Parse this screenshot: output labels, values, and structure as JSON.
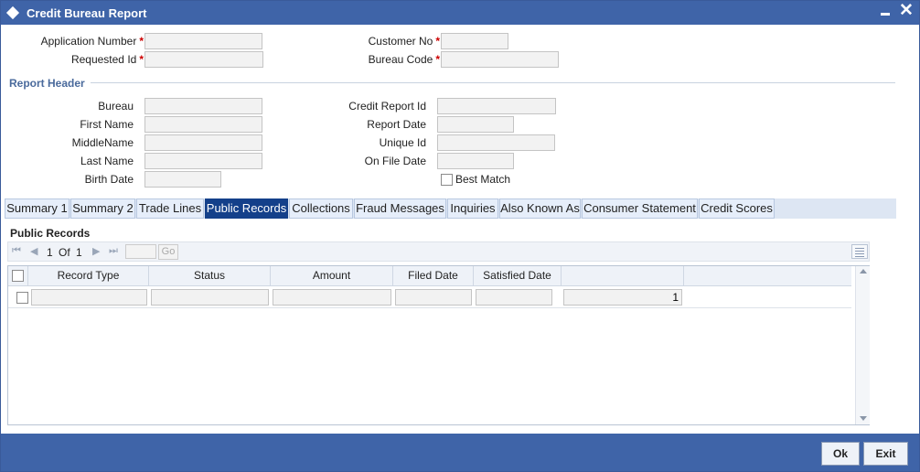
{
  "window": {
    "title": "Credit Bureau Report"
  },
  "form": {
    "application_number": {
      "label": "Application Number",
      "value": ""
    },
    "requested_id": {
      "label": "Requested Id",
      "value": ""
    },
    "customer_no": {
      "label": "Customer No",
      "value": ""
    },
    "bureau_code": {
      "label": "Bureau Code",
      "value": ""
    },
    "required_marker": "*"
  },
  "report_header": {
    "title": "Report Header",
    "bureau": {
      "label": "Bureau",
      "value": ""
    },
    "first_name": {
      "label": "First Name",
      "value": ""
    },
    "middle_name": {
      "label": "MiddleName",
      "value": ""
    },
    "last_name": {
      "label": "Last Name",
      "value": ""
    },
    "birth_date": {
      "label": "Birth Date",
      "value": ""
    },
    "credit_report_id": {
      "label": "Credit Report Id",
      "value": ""
    },
    "report_date": {
      "label": "Report Date",
      "value": ""
    },
    "unique_id": {
      "label": "Unique Id",
      "value": ""
    },
    "on_file_date": {
      "label": "On File Date",
      "value": ""
    },
    "best_match": {
      "label": "Best Match",
      "checked": false
    }
  },
  "tabs": [
    {
      "label": "Summary 1",
      "active": false
    },
    {
      "label": "Summary 2",
      "active": false
    },
    {
      "label": "Trade Lines",
      "active": false
    },
    {
      "label": "Public Records",
      "active": true
    },
    {
      "label": "Collections",
      "active": false
    },
    {
      "label": "Fraud Messages",
      "active": false
    },
    {
      "label": "Inquiries",
      "active": false
    },
    {
      "label": "Also Known As",
      "active": false
    },
    {
      "label": "Consumer Statement",
      "active": false
    },
    {
      "label": "Credit Scores",
      "active": false
    }
  ],
  "public_records": {
    "title": "Public Records",
    "pager": {
      "current": "1",
      "of_label": "Of",
      "total": "1",
      "go_label": "Go",
      "page_input": ""
    },
    "columns": [
      "Record Type",
      "Status",
      "Amount",
      "Filed Date",
      "Satisfied Date"
    ],
    "rows": [
      {
        "record_type": "",
        "status": "",
        "amount": "",
        "filed_date": "",
        "satisfied_date": "",
        "sequence": "1"
      }
    ]
  },
  "footer": {
    "ok_label": "Ok",
    "exit_label": "Exit"
  },
  "colors": {
    "titlebar": "#3f64a8",
    "active_tab": "#14408a",
    "section_title": "#4a6a9c",
    "required": "#cc0000"
  }
}
